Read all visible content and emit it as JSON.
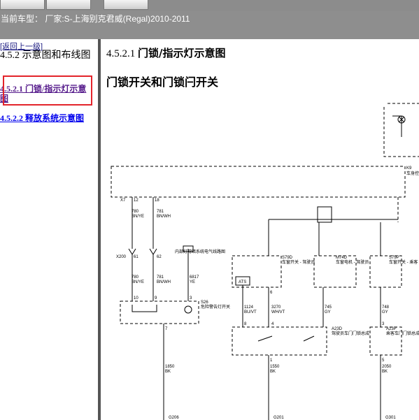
{
  "toolbar": {
    "buttons": [
      "",
      "",
      ""
    ]
  },
  "vehicle": {
    "info": "当前车型： 厂家:S-上海别克君威(Regal)2010-2011"
  },
  "sidebar": {
    "back_label": "[返回上一级]",
    "section_title": "4.5.2 示意图和布线图",
    "items": [
      {
        "label": "4.5.2.1 门锁/指示灯示意图"
      },
      {
        "label": "4.5.2.2 释放系统示意图"
      }
    ]
  },
  "main": {
    "title_number": "4.5.2.1",
    "title_text": "门锁/指示灯示意图",
    "subtitle": "门锁开关和门锁闩开关"
  },
  "diagram": {
    "k9": "K9",
    "k9_desc": "车身控制模块",
    "x7": "X7",
    "pins_top": [
      "12",
      "18"
    ],
    "wire_780": "780",
    "wire_780_color": "BN/YE",
    "wire_781": "781",
    "wire_781_color": "BN/WH",
    "x200": "X200",
    "pins_x200": [
      "61",
      "62"
    ],
    "note_inner": "内部灯常暗系统电气线路图",
    "wire_6817": "6817",
    "wire_6817_color": "YE",
    "pins_s26": [
      "10",
      "9",
      "3"
    ],
    "s26_code": "S26",
    "s26_desc": "危险警告灯开关",
    "pin_7": "7",
    "wire_1850": "1850",
    "wire_1850_color": "BK",
    "ground_g206": "G206",
    "ats": "ATS",
    "s79d": "S79D",
    "s79d_desc": "车窗开关 - 驾驶员",
    "m74d": "M74D",
    "m74d_desc": "车窗电机 - 驾驶员",
    "s79p": "S79P",
    "s79p_desc": "车窗开关 - 乘客",
    "pin_6": "6",
    "wire_1124": "1124",
    "wire_1124_color": "BU/VT",
    "wire_3270": "3270",
    "wire_3270_color": "WH/VT",
    "wire_745": "745",
    "wire_745_color": "GY",
    "wire_748": "748",
    "wire_748_color": "GY",
    "pins_a23": [
      "8",
      "4"
    ],
    "a23d": "A23D",
    "a23d_desc": "驾驶员车门门锁总成",
    "a23p": "A23P",
    "a23p_desc": "乘客车门门锁总成",
    "pin_a23p": "3",
    "pins_a23_bottom": [
      "1",
      "5"
    ],
    "wire_1550": "1550",
    "wire_1550_color": "BK",
    "wire_2050": "2050",
    "wire_2050_color": "BK",
    "ground_g201": "G201",
    "ground_g301": "G301"
  }
}
